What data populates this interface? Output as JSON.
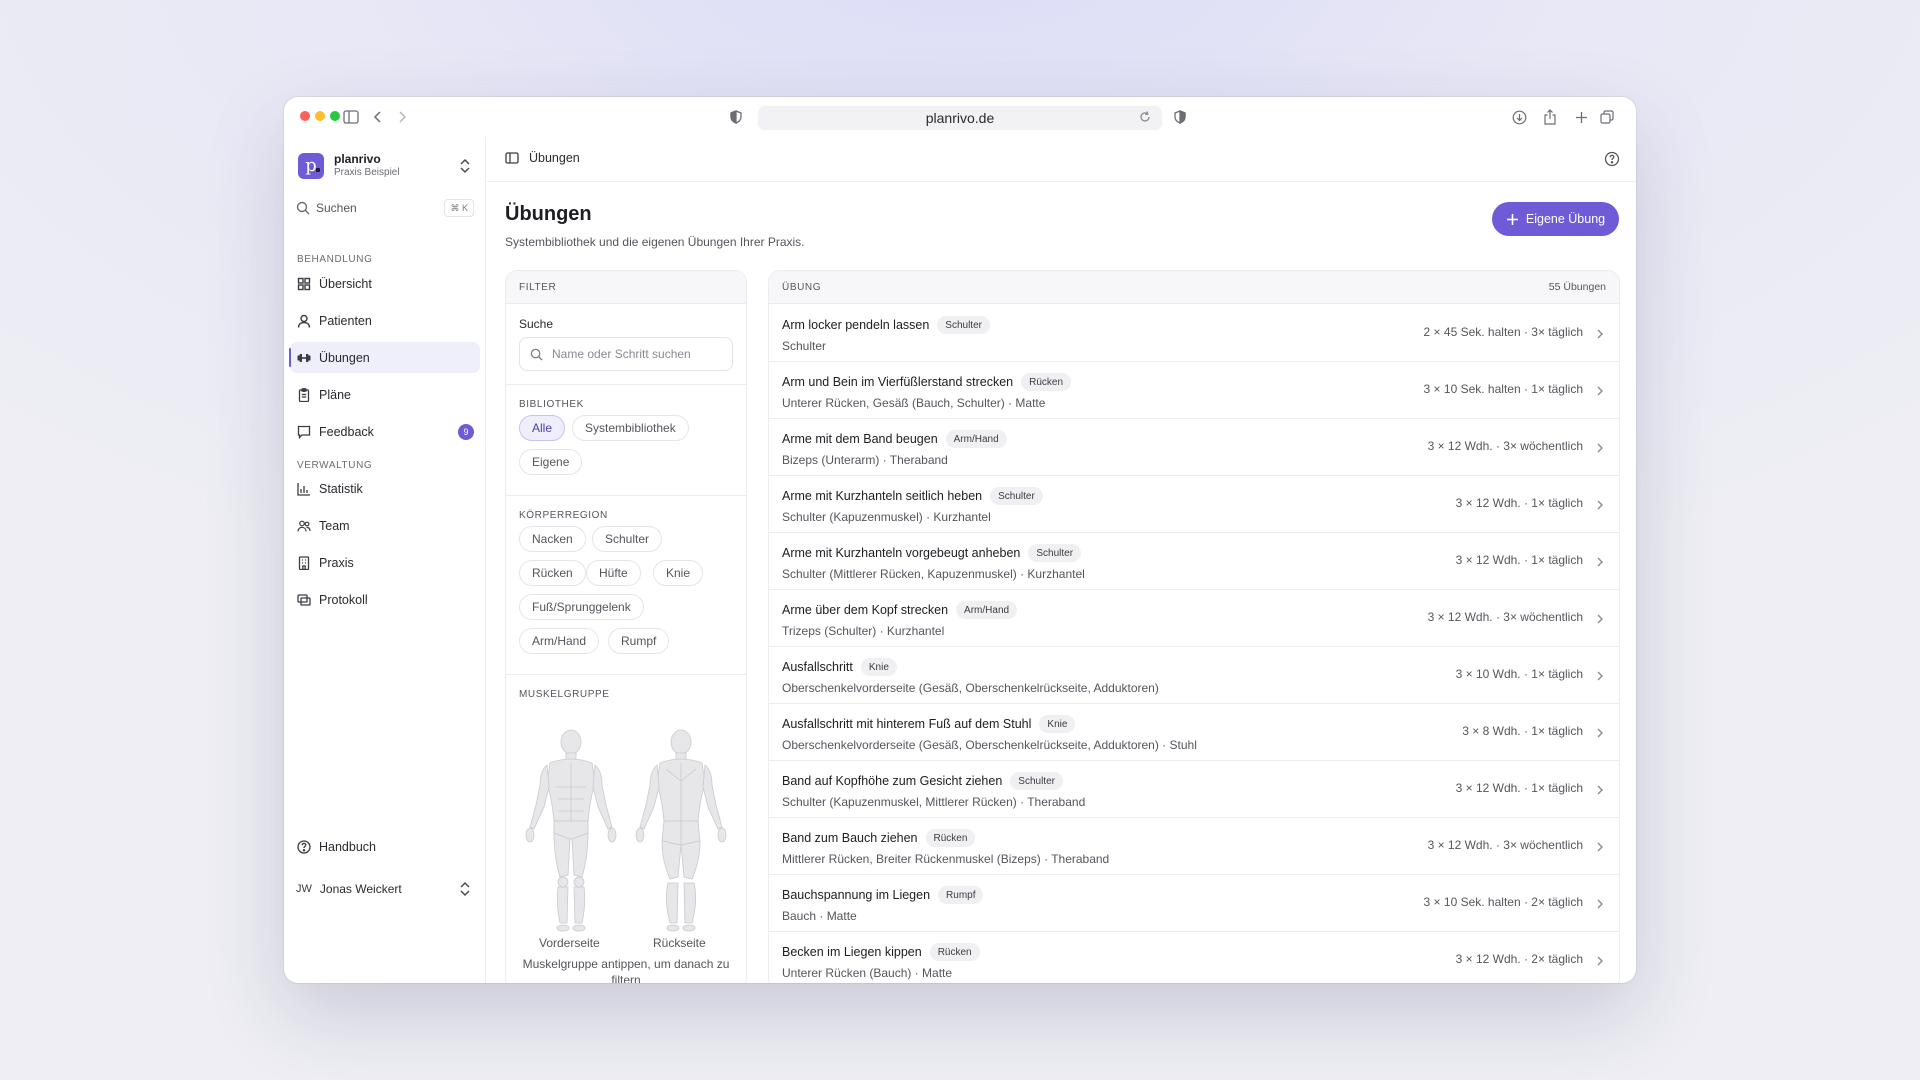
{
  "browser": {
    "url": "planrivo.de"
  },
  "sidebar": {
    "brand_name": "planrivo",
    "brand_sub": "Praxis Beispiel",
    "logo_letter": "p",
    "search_label": "Suchen",
    "search_shortcut": "⌘ K",
    "section_treatment": "BEHANDLUNG",
    "section_admin": "VERWALTUNG",
    "items": [
      {
        "label": "Übersicht",
        "icon": "grid-icon"
      },
      {
        "label": "Patienten",
        "icon": "user-icon"
      },
      {
        "label": "Übungen",
        "icon": "dumbbell-icon",
        "active": true
      },
      {
        "label": "Pläne",
        "icon": "clipboard-icon"
      },
      {
        "label": "Feedback",
        "icon": "message-icon",
        "badge": "9"
      },
      {
        "label": "Statistik",
        "icon": "chart-icon"
      },
      {
        "label": "Team",
        "icon": "users-icon"
      },
      {
        "label": "Praxis",
        "icon": "building-icon"
      },
      {
        "label": "Protokoll",
        "icon": "log-icon"
      }
    ],
    "handbook_label": "Handbuch",
    "user_initials": "JW",
    "user_name": "Jonas Weickert"
  },
  "topbar": {
    "breadcrumb": "Übungen"
  },
  "page": {
    "title": "Übungen",
    "subtitle": "Systembibliothek und die eigenen Übungen Ihrer Praxis.",
    "add_button": "Eigene Übung"
  },
  "filter": {
    "header": "FILTER",
    "search_label": "Suche",
    "search_placeholder": "Name oder Schritt suchen",
    "library_title": "BIBLIOTHEK",
    "library_chips": [
      "Alle",
      "Systembibliothek",
      "Eigene"
    ],
    "library_selected": "Alle",
    "region_title": "KÖRPERREGION",
    "region_chips": [
      "Nacken",
      "Schulter",
      "Rücken",
      "Hüfte",
      "Knie",
      "Fuß/Sprunggelenk",
      "Arm/Hand",
      "Rumpf"
    ],
    "muscle_title": "MUSKELGRUPPE",
    "front_label": "Vorderseite",
    "back_label": "Rückseite",
    "muscle_help": "Muskelgruppe antippen, um danach zu filtern"
  },
  "list": {
    "header": "ÜBUNG",
    "count": "55 Übungen",
    "rows": [
      {
        "title": "Arm locker pendeln lassen",
        "tag": "Schulter",
        "sub": "Schulter",
        "dose": "2 × 45 Sek. halten · 3× täglich"
      },
      {
        "title": "Arm und Bein im Vierfüßlerstand strecken",
        "tag": "Rücken",
        "sub": "Unterer Rücken, Gesäß (Bauch, Schulter) · Matte",
        "dose": "3 × 10 Sek. halten · 1× täglich"
      },
      {
        "title": "Arme mit dem Band beugen",
        "tag": "Arm/Hand",
        "sub": "Bizeps (Unterarm) · Theraband",
        "dose": "3 × 12 Wdh. · 3× wöchentlich"
      },
      {
        "title": "Arme mit Kurzhanteln seitlich heben",
        "tag": "Schulter",
        "sub": "Schulter (Kapuzenmuskel) · Kurzhantel",
        "dose": "3 × 12 Wdh. · 1× täglich"
      },
      {
        "title": "Arme mit Kurzhanteln vorgebeugt anheben",
        "tag": "Schulter",
        "sub": "Schulter (Mittlerer Rücken, Kapuzenmuskel) · Kurzhantel",
        "dose": "3 × 12 Wdh. · 1× täglich"
      },
      {
        "title": "Arme über dem Kopf strecken",
        "tag": "Arm/Hand",
        "sub": "Trizeps (Schulter) · Kurzhantel",
        "dose": "3 × 12 Wdh. · 3× wöchentlich"
      },
      {
        "title": "Ausfallschritt",
        "tag": "Knie",
        "sub": "Oberschenkelvorderseite (Gesäß, Oberschenkelrückseite, Adduktoren)",
        "dose": "3 × 10 Wdh. · 1× täglich"
      },
      {
        "title": "Ausfallschritt mit hinterem Fuß auf dem Stuhl",
        "tag": "Knie",
        "sub": "Oberschenkelvorderseite (Gesäß, Oberschenkelrückseite, Adduktoren) · Stuhl",
        "dose": "3 × 8 Wdh. · 1× täglich"
      },
      {
        "title": "Band auf Kopfhöhe zum Gesicht ziehen",
        "tag": "Schulter",
        "sub": "Schulter (Kapuzenmuskel, Mittlerer Rücken) · Theraband",
        "dose": "3 × 12 Wdh. · 1× täglich"
      },
      {
        "title": "Band zum Bauch ziehen",
        "tag": "Rücken",
        "sub": "Mittlerer Rücken, Breiter Rückenmuskel (Bizeps) · Theraband",
        "dose": "3 × 12 Wdh. · 3× wöchentlich"
      },
      {
        "title": "Bauchspannung im Liegen",
        "tag": "Rumpf",
        "sub": "Bauch · Matte",
        "dose": "3 × 10 Sek. halten · 2× täglich"
      },
      {
        "title": "Becken im Liegen kippen",
        "tag": "Rücken",
        "sub": "Unterer Rücken (Bauch) · Matte",
        "dose": "3 × 12 Wdh. · 2× täglich"
      }
    ]
  },
  "colors": {
    "accent": "#6f5bd6",
    "accent_soft": "#efeefb"
  }
}
